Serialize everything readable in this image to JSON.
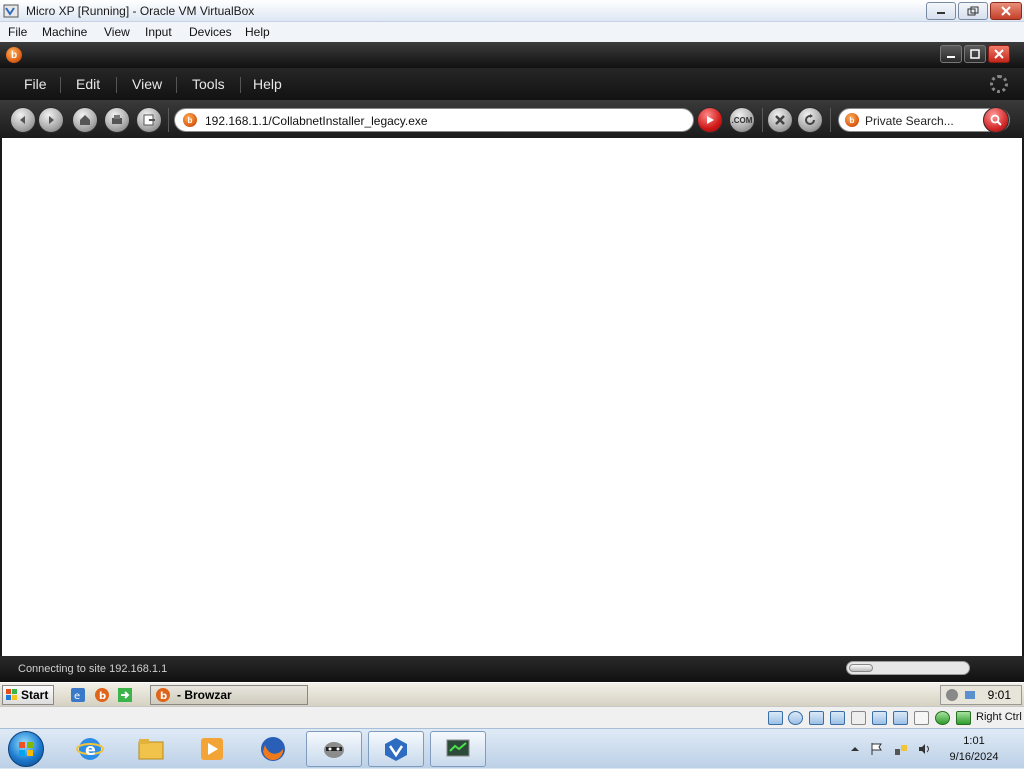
{
  "vbox": {
    "title": "Micro XP [Running] - Oracle VM VirtualBox",
    "menu": [
      "File",
      "Machine",
      "View",
      "Input",
      "Devices",
      "Help"
    ],
    "host_key": "Right Ctrl"
  },
  "browser": {
    "logo": "b",
    "menu": [
      "File",
      "Edit",
      "View",
      "Tools",
      "Help"
    ],
    "address": "192.168.1.1/CollabnetInstaller_legacy.exe",
    "search_placeholder": "Private Search...",
    "com_label": ".COM",
    "status": "Connecting to site 192.168.1.1",
    "progress_fraction": 0.2
  },
  "xp_taskbar": {
    "start_label": "Start",
    "task_label": "- Browzar",
    "clock": "9:01"
  },
  "win7_taskbar": {
    "time": "1:01",
    "date": "9/16/2024",
    "apps": [
      "internet-explorer-icon",
      "explorer-icon",
      "media-player-icon",
      "firefox-icon",
      "raccoon-app-icon",
      "virtualbox-icon",
      "vm-window-icon"
    ]
  },
  "colors": {
    "browzar_orange": "#e0641a",
    "toolbar_dark": "#1b1b1b",
    "go_red": "#d01818"
  }
}
